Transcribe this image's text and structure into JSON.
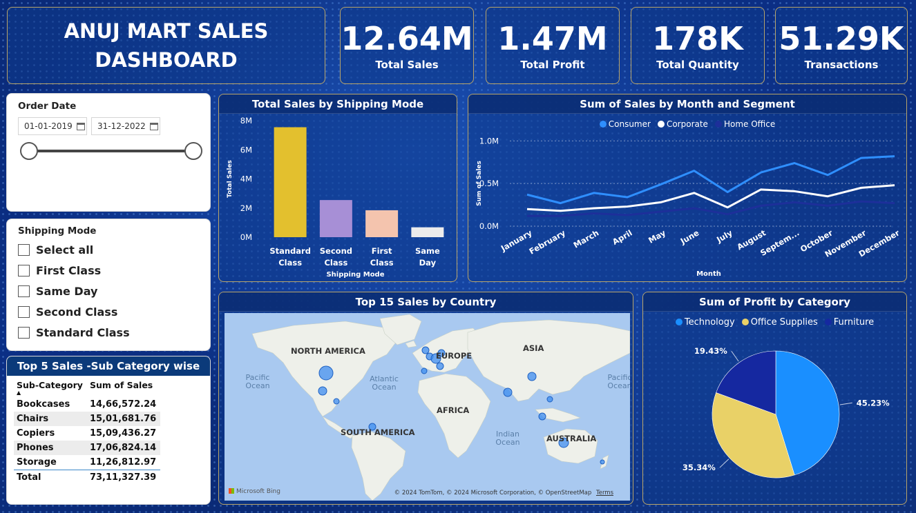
{
  "header": {
    "title": "ANUJ MART SALES DASHBOARD"
  },
  "kpis": [
    {
      "value": "12.64M",
      "label": "Total Sales"
    },
    {
      "value": "1.47M",
      "label": "Total Profit"
    },
    {
      "value": "178K",
      "label": "Total Quantity"
    },
    {
      "value": "51.29K",
      "label": "Transactions"
    }
  ],
  "order_date": {
    "title": "Order Date",
    "start": "01-01-2019",
    "end": "31-12-2022",
    "range_fraction": [
      0.0,
      1.0
    ]
  },
  "shipping_slicer": {
    "title": "Shipping Mode",
    "options": [
      "Select all",
      "First Class",
      "Same Day",
      "Second Class",
      "Standard Class"
    ]
  },
  "top5": {
    "title": "Top 5 Sales -Sub Category wise",
    "headers": [
      "Sub-Category",
      "Sum of Sales"
    ],
    "rows": [
      [
        "Bookcases",
        "14,66,572.24"
      ],
      [
        "Chairs",
        "15,01,681.76"
      ],
      [
        "Copiers",
        "15,09,436.27"
      ],
      [
        "Phones",
        "17,06,824.14"
      ],
      [
        "Storage",
        "11,26,812.97"
      ]
    ],
    "total": [
      "Total",
      "73,11,327.39"
    ]
  },
  "map": {
    "title": "Top 15 Sales by Country",
    "continents": [
      "NORTH AMERICA",
      "EUROPE",
      "ASIA",
      "AFRICA",
      "SOUTH AMERICA",
      "AUSTRALIA"
    ],
    "oceans": [
      "Pacific Ocean",
      "Atlantic Ocean",
      "Indian Ocean",
      "Pacific Ocean"
    ],
    "attribution": "© 2024 TomTom, © 2024 Microsoft Corporation, © OpenStreetMap",
    "terms": "Terms",
    "bing": "Microsoft Bing"
  },
  "chart_data": [
    {
      "type": "bar",
      "title": "Total Sales by Shipping Mode",
      "xlabel": "Shipping Mode",
      "ylabel": "Total Sales",
      "categories": [
        "Standard Class",
        "Second Class",
        "First Class",
        "Same Day"
      ],
      "values": [
        7.55,
        2.55,
        1.85,
        0.68
      ],
      "value_unit": "M",
      "yticks": [
        "0M",
        "2M",
        "4M",
        "6M",
        "8M"
      ],
      "ylim": [
        0,
        8
      ],
      "colors": [
        "#e3c02e",
        "#a78fd6",
        "#f4c4ae",
        "#ececec"
      ]
    },
    {
      "type": "line",
      "title": "Sum of Sales by Month and Segment",
      "xlabel": "Month",
      "ylabel": "Sum of Sales",
      "categories": [
        "January",
        "February",
        "March",
        "April",
        "May",
        "June",
        "July",
        "August",
        "Septem...",
        "October",
        "November",
        "December"
      ],
      "yticks": [
        "0.0M",
        "0.5M",
        "1.0M"
      ],
      "ylim": [
        0,
        1.1
      ],
      "series": [
        {
          "name": "Consumer",
          "color": "#2f8fff",
          "values": [
            0.37,
            0.27,
            0.39,
            0.34,
            0.49,
            0.65,
            0.4,
            0.63,
            0.74,
            0.6,
            0.8,
            0.82
          ]
        },
        {
          "name": "Corporate",
          "color": "#ffffff",
          "values": [
            0.2,
            0.18,
            0.21,
            0.23,
            0.28,
            0.39,
            0.22,
            0.43,
            0.41,
            0.35,
            0.45,
            0.48
          ]
        },
        {
          "name": "Home Office",
          "color": "#1d2f9a",
          "values": [
            0.12,
            0.12,
            0.15,
            0.13,
            0.17,
            0.21,
            0.14,
            0.24,
            0.28,
            0.24,
            0.29,
            0.27
          ]
        }
      ]
    },
    {
      "type": "pie",
      "title": "Sum of Profit by Category",
      "labels": [
        "Technology",
        "Office Supplies",
        "Furniture"
      ],
      "values": [
        45.23,
        35.34,
        19.43
      ],
      "value_labels": [
        "45.23%",
        "35.34%",
        "19.43%"
      ],
      "colors": [
        "#1a8fff",
        "#e9d167",
        "#1528a0"
      ]
    }
  ]
}
